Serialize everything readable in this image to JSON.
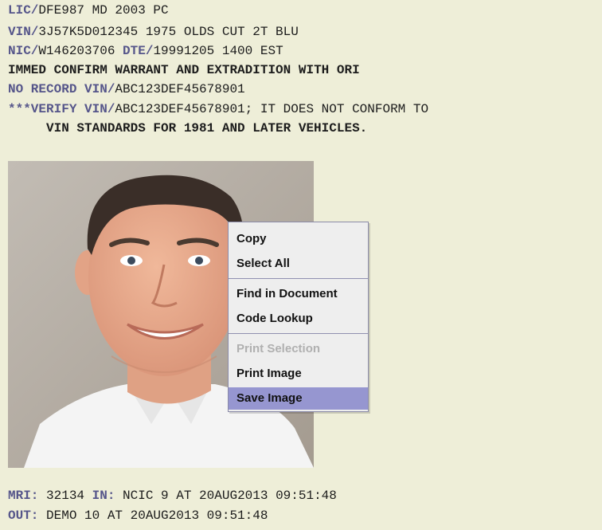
{
  "report": {
    "lines": [
      {
        "key": "LIC/",
        "value": "DFE987 MD 2003 PC"
      },
      {
        "key": "VIN/",
        "value": "3J57K5D012345 1975 OLDS CUT 2T BLU"
      },
      {
        "key": "NIC/",
        "value": "W146203706 ",
        "key2": "DTE/",
        "value2": "19991205 1400 EST"
      }
    ],
    "confirm_message": "IMMED CONFIRM WARRANT AND EXTRADITION WITH ORI",
    "no_record": {
      "key": "NO RECORD VIN/",
      "value": "ABC123DEF45678901"
    },
    "verify": {
      "key": "***VERIFY VIN/",
      "value": "ABC123DEF45678901; IT DOES NOT CONFORM TO",
      "continuation": "VIN STANDARDS FOR 1981 AND LATER VEHICLES."
    },
    "footer": {
      "mri_key": "MRI:",
      "mri_value": " 32134 ",
      "in_key": "IN:",
      "in_value": " NCIC 9 AT 20AUG2013 09:51:48",
      "out_key": "OUT:",
      "out_value": " DEMO 10 AT 20AUG2013 09:51:48"
    }
  },
  "context_menu": {
    "items": [
      {
        "label": "Copy",
        "enabled": true
      },
      {
        "label": "Select All",
        "enabled": true
      },
      {
        "label": "Find in Document",
        "enabled": true
      },
      {
        "label": "Code Lookup",
        "enabled": true
      },
      {
        "label": "Print Selection",
        "enabled": false
      },
      {
        "label": "Print Image",
        "enabled": true
      },
      {
        "label": "Save Image",
        "enabled": true,
        "highlighted": true
      }
    ]
  },
  "colors": {
    "background": "#eeeed8",
    "field_key": "#55558a",
    "menu_highlight": "#9696d0"
  }
}
